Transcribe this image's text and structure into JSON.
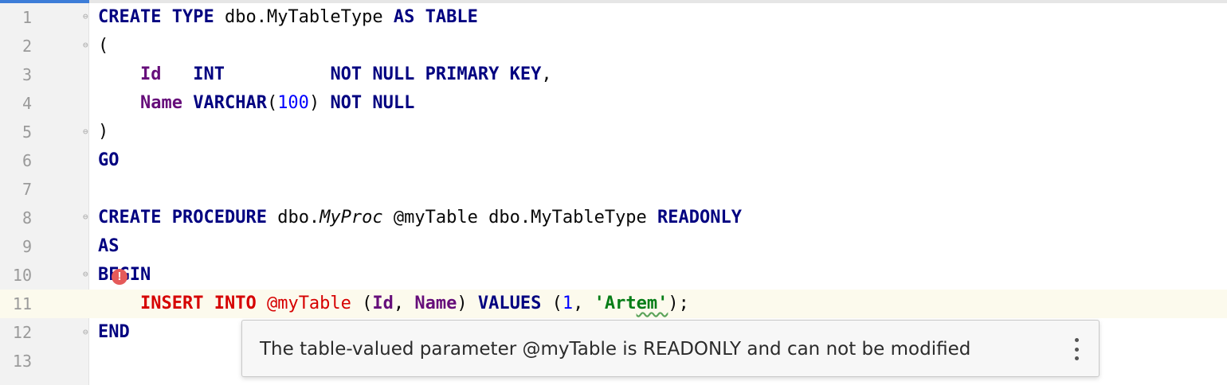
{
  "editor": {
    "current_line": 11,
    "lines": [
      {
        "num": "1",
        "fold": "start",
        "tokens": [
          {
            "t": "CREATE",
            "c": "kw"
          },
          {
            "t": " "
          },
          {
            "t": "TYPE",
            "c": "kw"
          },
          {
            "t": " dbo.MyTableType "
          },
          {
            "t": "AS",
            "c": "kw"
          },
          {
            "t": " "
          },
          {
            "t": "TABLE",
            "c": "kw"
          }
        ]
      },
      {
        "num": "2",
        "fold": "start",
        "tokens": [
          {
            "t": "("
          }
        ]
      },
      {
        "num": "3",
        "tokens": [
          {
            "t": "    "
          },
          {
            "t": "Id",
            "c": "col"
          },
          {
            "t": "   "
          },
          {
            "t": "INT",
            "c": "kw"
          },
          {
            "t": "          "
          },
          {
            "t": "NOT NULL PRIMARY KEY",
            "c": "kw"
          },
          {
            "t": ","
          }
        ]
      },
      {
        "num": "4",
        "tokens": [
          {
            "t": "    "
          },
          {
            "t": "Name",
            "c": "col"
          },
          {
            "t": " "
          },
          {
            "t": "VARCHAR",
            "c": "kw"
          },
          {
            "t": "("
          },
          {
            "t": "100",
            "c": "num"
          },
          {
            "t": ") "
          },
          {
            "t": "NOT NULL",
            "c": "kw"
          }
        ]
      },
      {
        "num": "5",
        "fold": "end",
        "tokens": [
          {
            "t": ")"
          }
        ]
      },
      {
        "num": "6",
        "tokens": [
          {
            "t": "GO",
            "c": "kw"
          }
        ]
      },
      {
        "num": "7",
        "tokens": []
      },
      {
        "num": "8",
        "fold": "start",
        "tokens": [
          {
            "t": "CREATE",
            "c": "kw"
          },
          {
            "t": " "
          },
          {
            "t": "PROCEDURE",
            "c": "kw"
          },
          {
            "t": " dbo."
          },
          {
            "t": "MyProc",
            "c": "ital"
          },
          {
            "t": " @myTable dbo.MyTableType "
          },
          {
            "t": "READONLY",
            "c": "kw"
          }
        ]
      },
      {
        "num": "9",
        "tokens": [
          {
            "t": "AS",
            "c": "kw"
          }
        ]
      },
      {
        "num": "10",
        "fold": "start",
        "tokens": [
          {
            "t": "BEGIN",
            "c": "kw"
          }
        ]
      },
      {
        "num": "11",
        "tokens": [
          {
            "t": "    "
          },
          {
            "t": "INSERT",
            "c": "err-kw"
          },
          {
            "t": " "
          },
          {
            "t": "INTO",
            "c": "err-kw"
          },
          {
            "t": " "
          },
          {
            "t": "@myTable",
            "c": "err-var"
          },
          {
            "t": " ("
          },
          {
            "t": "Id",
            "c": "col"
          },
          {
            "t": ", "
          },
          {
            "t": "Name",
            "c": "col"
          },
          {
            "t": ") "
          },
          {
            "t": "VALUES",
            "c": "kw"
          },
          {
            "t": " ("
          },
          {
            "t": "1",
            "c": "num"
          },
          {
            "t": ", "
          },
          {
            "t": "'Art",
            "c": "str"
          },
          {
            "t": "em'",
            "c": "str squiggle"
          },
          {
            "t": ");"
          }
        ]
      },
      {
        "num": "12",
        "fold": "end",
        "tokens": [
          {
            "t": "END",
            "c": "kw"
          }
        ]
      },
      {
        "num": "13",
        "tokens": []
      }
    ]
  },
  "gutter_marker": {
    "symbol": "!",
    "icon": "error-icon",
    "color": "#e55a5a"
  },
  "tooltip": {
    "message": "The table-valued parameter @myTable is READONLY and can not be modified",
    "more_icon": "more-vertical-icon"
  }
}
